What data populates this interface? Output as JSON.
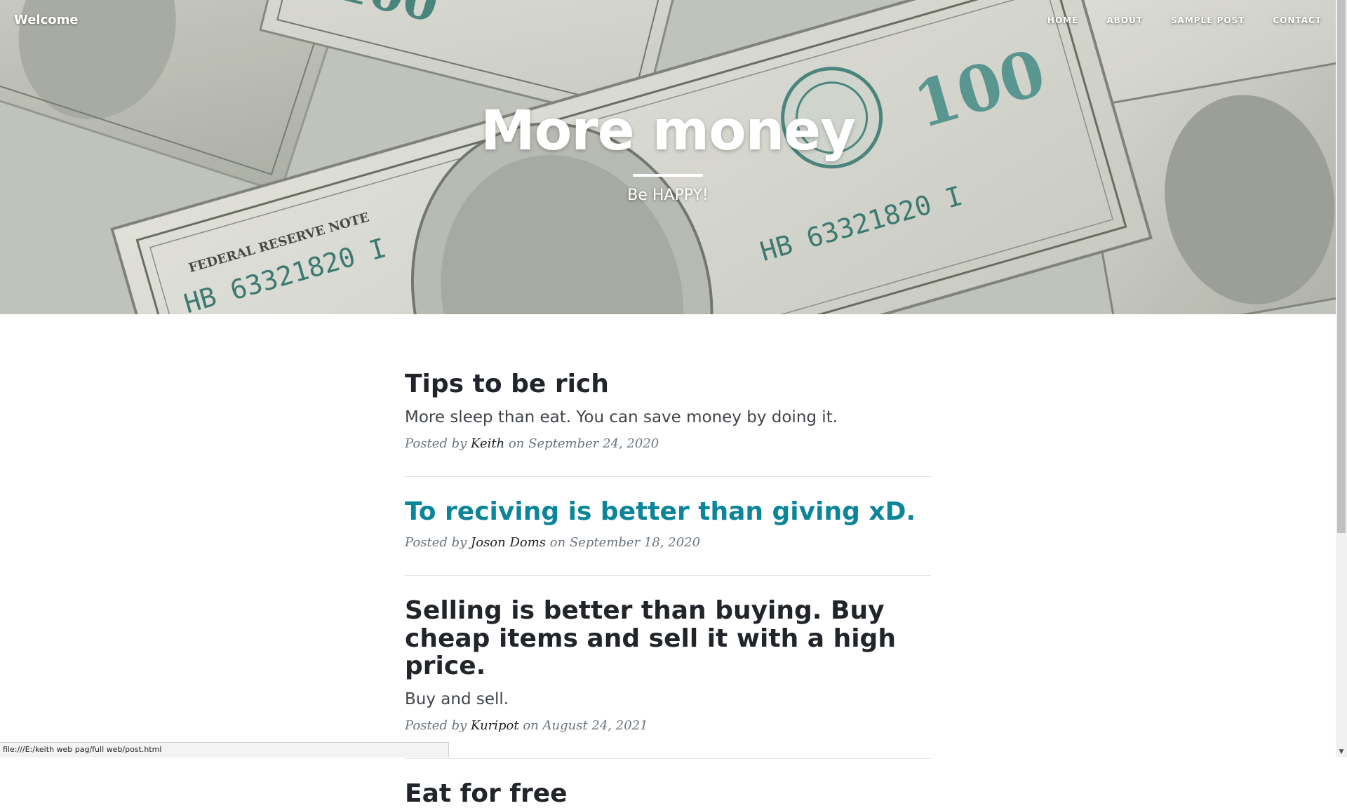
{
  "navbar": {
    "brand": "Welcome",
    "links": [
      "HOME",
      "ABOUT",
      "SAMPLE POST",
      "CONTACT"
    ]
  },
  "hero": {
    "title": "More money",
    "subtitle": "Be HAPPY!"
  },
  "posts": [
    {
      "title": "Tips to be rich",
      "subtitle": "More sleep than eat. You can save money by doing it.",
      "meta_prefix": "Posted by",
      "author": "Keith",
      "meta_on": "on",
      "date": "September 24, 2020"
    },
    {
      "title": "To reciving is better than giving xD.",
      "subtitle": "",
      "meta_prefix": "Posted by",
      "author": "Joson Doms",
      "meta_on": "on",
      "date": "September 18, 2020"
    },
    {
      "title": "Selling is better than buying. Buy cheap items and sell it with a high price.",
      "subtitle": "Buy and sell.",
      "meta_prefix": "Posted by",
      "author": "Kuripot",
      "meta_on": "on",
      "date": "August 24, 2021"
    },
    {
      "title": "Eat for free",
      "subtitle": "",
      "meta_prefix": "",
      "author": "",
      "meta_on": "",
      "date": ""
    }
  ],
  "status_bar": {
    "url": "file:///E:/keith web pag/full web/post.html"
  },
  "colors": {
    "link_hover": "#0b8599",
    "heading": "#212529",
    "meta": "#6c757d"
  },
  "icons": {
    "scroll_up": "triangle-up",
    "scroll_down": "triangle-down"
  }
}
